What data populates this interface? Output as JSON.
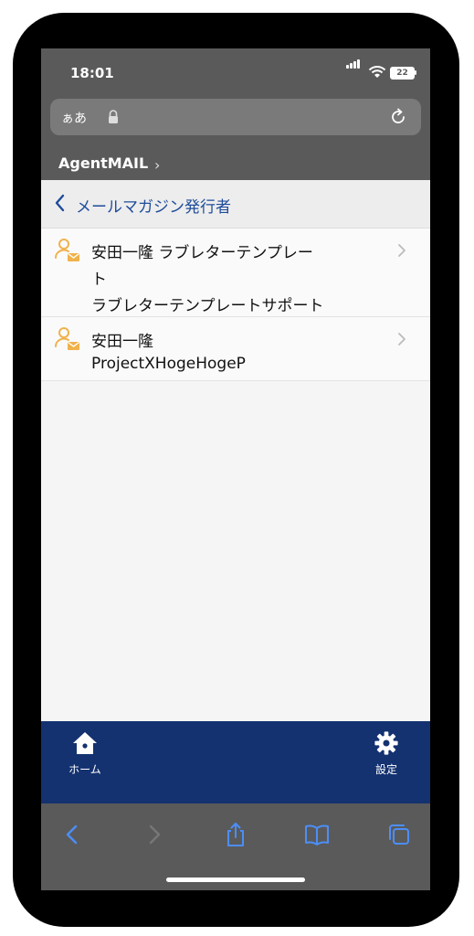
{
  "status": {
    "time": "18:01",
    "battery": "22"
  },
  "browser": {
    "text_size_label": "ぁあ"
  },
  "app": {
    "title": "AgentMAIL"
  },
  "nav": {
    "title": "メールマガジン発行者"
  },
  "list": [
    {
      "lines": [
        "安田一隆 ラブレターテンプレー",
        "ト",
        "ラブレターテンプレートサポート"
      ]
    },
    {
      "lines": [
        "安田一隆",
        "ProjectXHogeHogeP"
      ]
    }
  ],
  "tabs": {
    "home_label": "ホーム",
    "settings_label": "設定"
  },
  "colors": {
    "tabbar": "#143270",
    "accent_blue": "#1e4c9a",
    "icon_orange": "#f0b24c",
    "browser_chrome": "#5a5a5a"
  }
}
